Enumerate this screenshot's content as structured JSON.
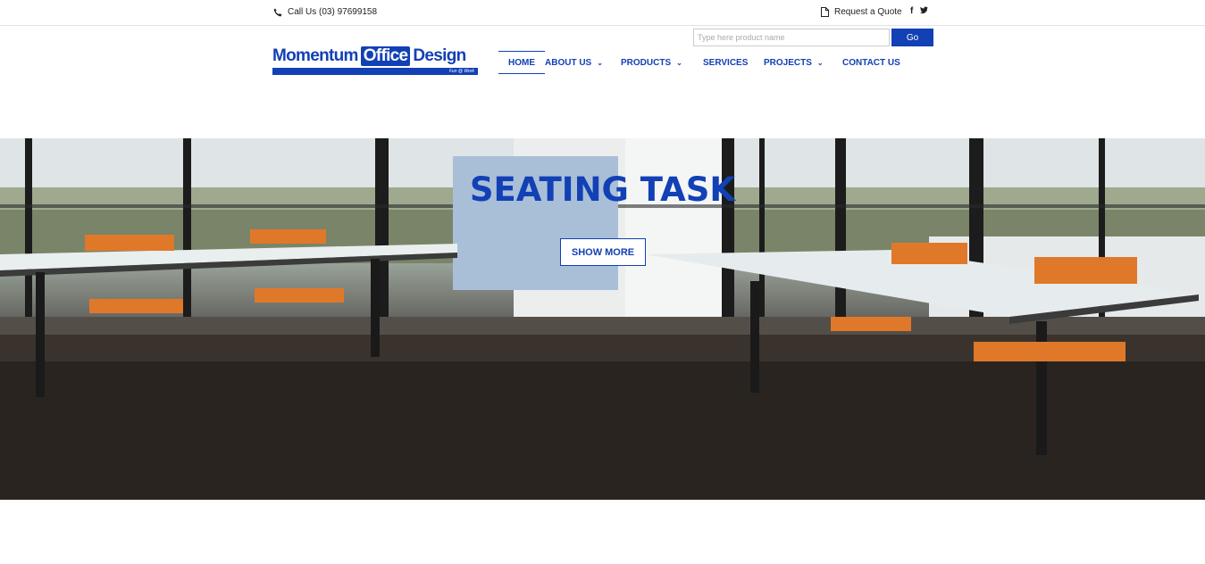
{
  "topbar": {
    "phone_text": "Call Us (03) 97699158",
    "quote_text": "Request a Quote",
    "social": [
      "f",
      "twitter"
    ]
  },
  "search": {
    "placeholder": "Type here product name",
    "button_label": "Go"
  },
  "logo": {
    "part1": "Momentum",
    "part2": "Office",
    "part3": "Design",
    "tagline": "Fun @ Work"
  },
  "nav": {
    "items": [
      {
        "label": "HOME",
        "has_menu": false,
        "active": true
      },
      {
        "label": "ABOUT US",
        "has_menu": true
      },
      {
        "label": "PRODUCTS",
        "has_menu": true
      },
      {
        "label": "SERVICES",
        "has_menu": false
      },
      {
        "label": "PROJECTS",
        "has_menu": true
      },
      {
        "label": "CONTACT US",
        "has_menu": false
      }
    ]
  },
  "hero": {
    "title": "SEATING TASK",
    "button_label": "SHOW MORE"
  },
  "colors": {
    "brand_blue": "#1240b5",
    "text_dark": "#222222"
  },
  "icons": {
    "phone": "phone-icon",
    "quote": "document-icon",
    "facebook": "facebook-icon",
    "twitter": "twitter-icon",
    "chevron": "chevron-down-icon"
  }
}
